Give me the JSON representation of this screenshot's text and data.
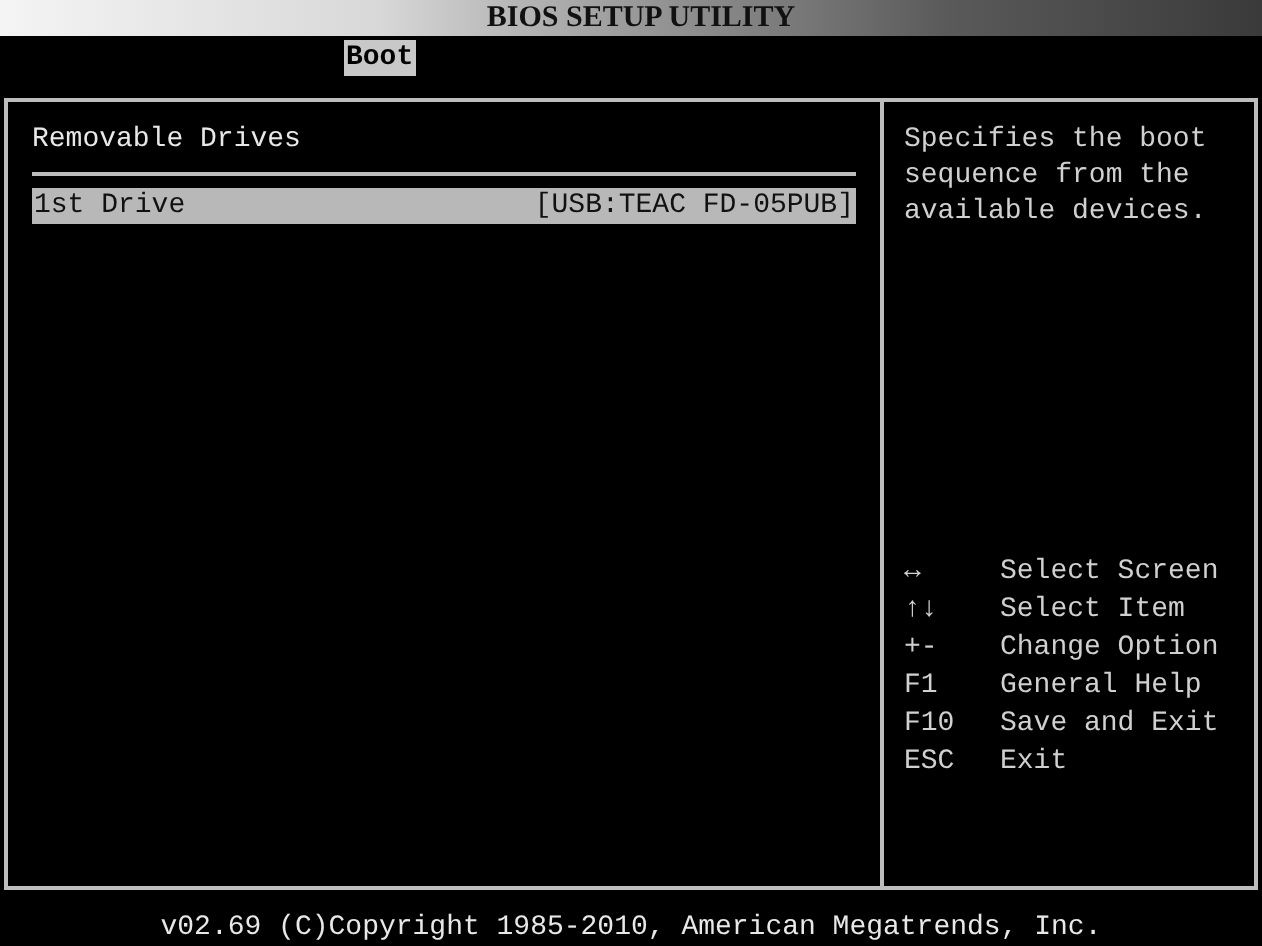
{
  "window": {
    "title": "BIOS SETUP UTILITY"
  },
  "tabs": [
    {
      "label": "Boot",
      "selected": true
    }
  ],
  "main": {
    "heading": "Removable Drives",
    "items": [
      {
        "label": "1st Drive",
        "value": "[USB:TEAC FD-05PUB]",
        "selected": true
      }
    ]
  },
  "help": {
    "description": "Specifies the boot sequence from the available devices.",
    "keys": [
      {
        "key": "↔",
        "action": "Select Screen"
      },
      {
        "key": "↑↓",
        "action": "Select Item"
      },
      {
        "key": "+-",
        "action": "Change Option"
      },
      {
        "key": "F1",
        "action": "General Help"
      },
      {
        "key": "F10",
        "action": "Save and Exit"
      },
      {
        "key": "ESC",
        "action": "Exit"
      }
    ]
  },
  "status_bar": "v02.69 (C)Copyright 1985-2010, American Megatrends, Inc."
}
